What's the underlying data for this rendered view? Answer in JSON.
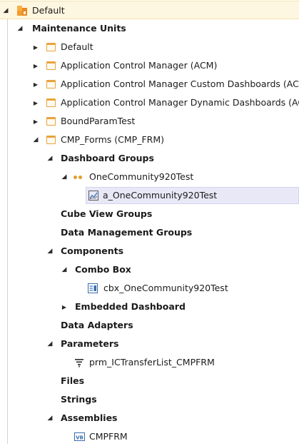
{
  "tree": {
    "root": {
      "label": "Default",
      "icon": "app-root-icon"
    },
    "maintenance_units": {
      "label": "Maintenance Units"
    },
    "units": [
      {
        "label": "Default"
      },
      {
        "label": "Application Control Manager (ACM)"
      },
      {
        "label": "Application Control Manager Custom Dashboards (ACM)"
      },
      {
        "label": "Application Control Manager Dynamic Dashboards (ACM"
      },
      {
        "label": "BoundParamTest"
      },
      {
        "label": "CMP_Forms (CMP_FRM)"
      }
    ],
    "cmp_forms": {
      "dashboard_groups": "Dashboard Groups",
      "group": "OneCommunity920Test",
      "dashboard": "a_OneCommunity920Test",
      "cube_view_groups": "Cube View Groups",
      "data_management_groups": "Data Management Groups",
      "components": "Components",
      "combo_box": "Combo Box",
      "combo_item": "cbx_OneCommunity920Test",
      "embedded_dashboard": "Embedded Dashboard",
      "data_adapters": "Data Adapters",
      "parameters": "Parameters",
      "parameter_item": "prm_ICTransferList_CMPFRM",
      "files": "Files",
      "strings": "Strings",
      "assemblies": "Assemblies",
      "assembly_item": "CMPFRM",
      "assembly_badge": "VB"
    }
  },
  "colors": {
    "folder": "#e8a33a",
    "root_bg": "#fdf6e0",
    "selection_bg": "#e8e8f7",
    "icon_blue": "#3a6db0"
  }
}
